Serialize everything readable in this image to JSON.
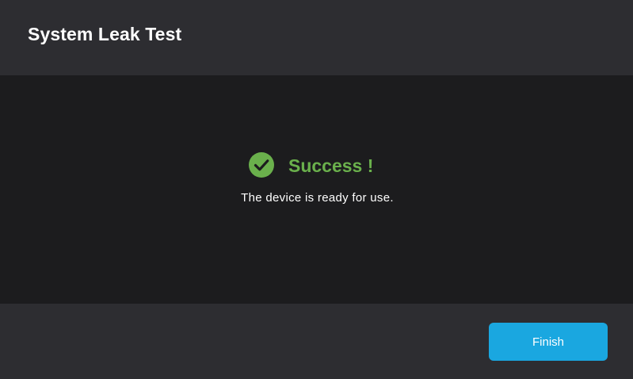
{
  "header": {
    "title": "System Leak Test"
  },
  "status": {
    "icon": "check-circle-icon",
    "icon_color": "#6ab04c",
    "heading": "Success !",
    "message": "The device is ready for use."
  },
  "footer": {
    "finish_label": "Finish"
  },
  "colors": {
    "accent": "#1aa7e0",
    "success": "#6ab04c",
    "panel": "#2d2d31",
    "background": "#1c1c1e"
  }
}
